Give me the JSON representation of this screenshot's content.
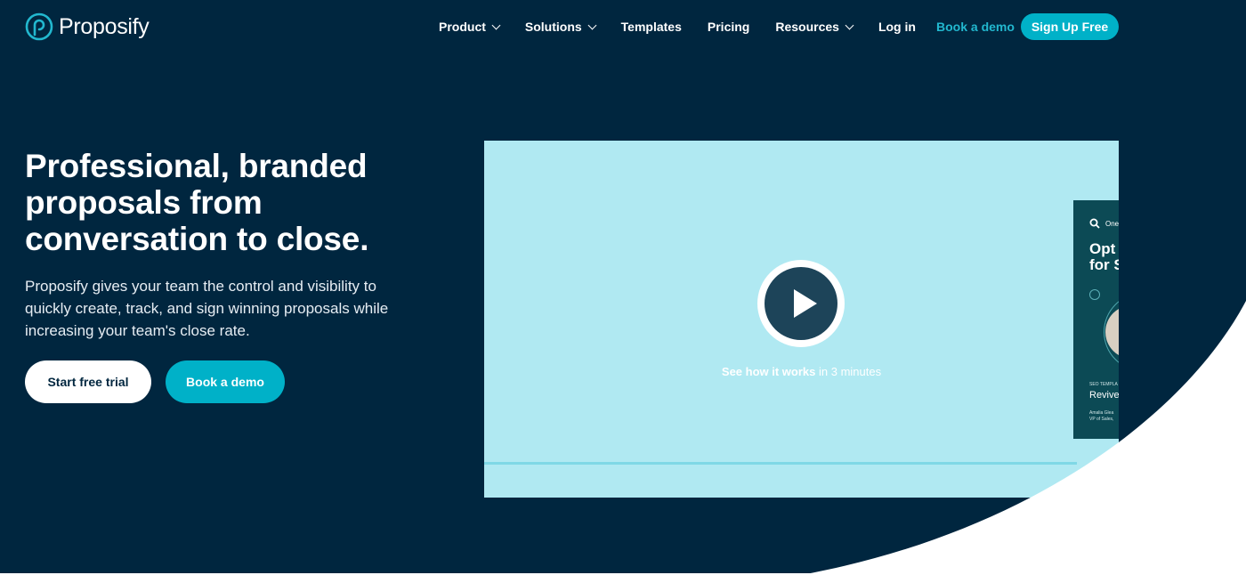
{
  "brand": {
    "name": "Proposify",
    "colors": {
      "background": "#00263f",
      "accent": "#00b1c8",
      "video_bg": "#b0e9f2"
    }
  },
  "nav": {
    "items": [
      {
        "label": "Product",
        "has_dropdown": true
      },
      {
        "label": "Solutions",
        "has_dropdown": true
      },
      {
        "label": "Templates",
        "has_dropdown": false
      },
      {
        "label": "Pricing",
        "has_dropdown": false
      },
      {
        "label": "Resources",
        "has_dropdown": true
      },
      {
        "label": "Log in",
        "has_dropdown": false
      }
    ],
    "book_demo": "Book a demo",
    "signup": "Sign Up Free"
  },
  "hero": {
    "title_lines": [
      "Professional, branded",
      "proposals from",
      "conversation to close."
    ],
    "subtitle_lines": [
      "Proposify gives your team the control and visibility to",
      "quickly create, track, and sign winning proposals while",
      "increasing your team's close rate."
    ],
    "cta_primary": "Start free trial",
    "cta_secondary": "Book a demo"
  },
  "video": {
    "caption_bold": "See how it works",
    "caption_rest": " in 3 minutes",
    "icons": {
      "play": "play-icon"
    },
    "thumbnail": {
      "brand": "One",
      "title_lines": [
        "Opt",
        "for S"
      ],
      "tag": "SEO TEMPLA",
      "headline": "Revive",
      "person_lines": [
        "Amalia Glea",
        "VP of Sales,"
      ]
    }
  }
}
